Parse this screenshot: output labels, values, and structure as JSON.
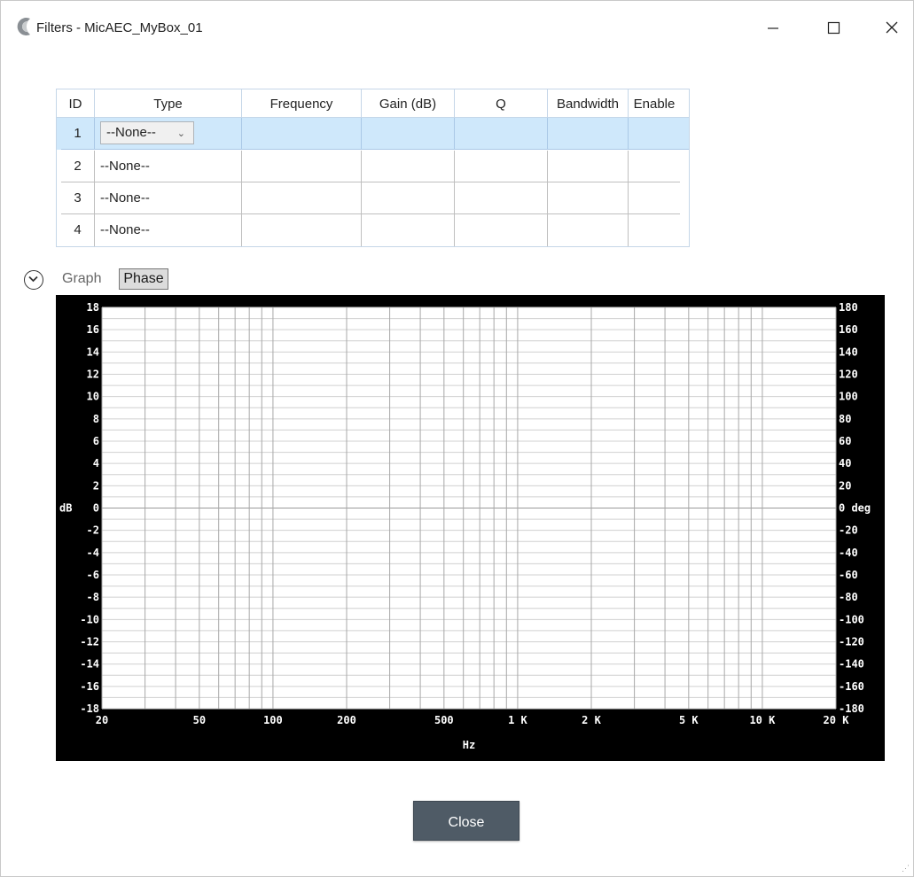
{
  "window": {
    "title": "Filters - MicAEC_MyBox_01",
    "icon": "app-logo-c-icon",
    "controls": [
      "minimize-icon",
      "maximize-icon",
      "close-icon"
    ]
  },
  "grid": {
    "headers": [
      "ID",
      "Type",
      "Frequency",
      "Gain  (dB)",
      "Q",
      "Bandwidth",
      "Enable"
    ],
    "rows": [
      {
        "id": "1",
        "type": "--None--",
        "frequency": "",
        "gain": "",
        "q": "",
        "bandwidth": "",
        "enable": "",
        "selected": true
      },
      {
        "id": "2",
        "type": "--None--",
        "frequency": "",
        "gain": "",
        "q": "",
        "bandwidth": "",
        "enable": ""
      },
      {
        "id": "3",
        "type": "--None--",
        "frequency": "",
        "gain": "",
        "q": "",
        "bandwidth": "",
        "enable": ""
      },
      {
        "id": "4",
        "type": "--None--",
        "frequency": "",
        "gain": "",
        "q": "",
        "bandwidth": "",
        "enable": ""
      }
    ]
  },
  "graph_toolbar": {
    "expander_icon": "chevron-down-circle-icon",
    "label": "Graph",
    "phase_button": "Phase"
  },
  "chart_data": {
    "type": "line",
    "series": [],
    "x_scale": "log",
    "xlim": [
      20,
      20000
    ],
    "x_ticks": [
      {
        "v": 20,
        "label": "20"
      },
      {
        "v": 50,
        "label": "50"
      },
      {
        "v": 100,
        "label": "100"
      },
      {
        "v": 200,
        "label": "200"
      },
      {
        "v": 500,
        "label": "500"
      },
      {
        "v": 1000,
        "label": "1 K"
      },
      {
        "v": 2000,
        "label": "2 K"
      },
      {
        "v": 5000,
        "label": "5 K"
      },
      {
        "v": 10000,
        "label": "10 K"
      },
      {
        "v": 20000,
        "label": "20 K"
      }
    ],
    "xlabel": "Hz",
    "ylim": [
      -18,
      18
    ],
    "y_ticks": [
      18,
      16,
      14,
      12,
      10,
      8,
      6,
      4,
      2,
      0,
      -2,
      -4,
      -6,
      -8,
      -10,
      -12,
      -14,
      -16,
      -18
    ],
    "ylabel": "dB",
    "y2lim": [
      -180,
      180
    ],
    "y2_ticks": [
      180,
      160,
      140,
      120,
      100,
      80,
      60,
      40,
      20,
      0,
      -20,
      -40,
      -60,
      -80,
      -100,
      -120,
      -140,
      -160,
      -180
    ],
    "y2_zero_label": "0 deg",
    "grid": true,
    "background": "#000000",
    "plot_background": "#ffffff"
  },
  "footer": {
    "close_label": "Close"
  }
}
